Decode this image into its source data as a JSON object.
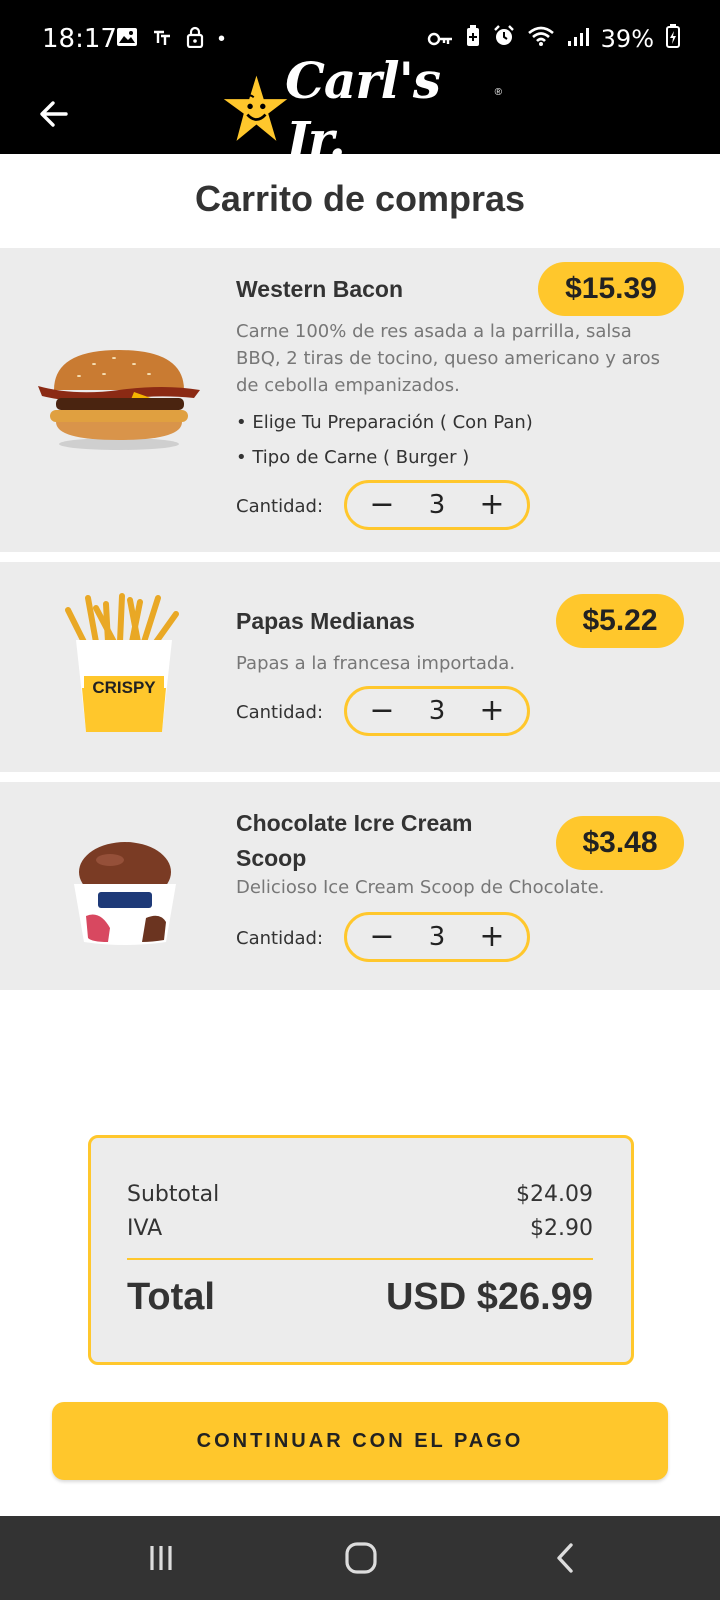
{
  "status_bar": {
    "time": "18:17",
    "dot": "•",
    "battery": "39%"
  },
  "header": {
    "brand": "Carl's Jr.",
    "brand_reg": "®"
  },
  "page": {
    "title": "Carrito de compras"
  },
  "items": [
    {
      "name": "Western Bacon",
      "price": "$15.39",
      "description": "Carne 100% de res asada a la parrilla, salsa BBQ, 2 tiras de tocino, queso americano y aros de cebolla empanizados.",
      "options": [
        "• Elige Tu Preparación ( Con Pan)",
        "• Tipo de Carne ( Burger )"
      ],
      "quantity_label": "Cantidad:",
      "quantity": "3",
      "minus": "−",
      "plus": "+"
    },
    {
      "name": "Papas Medianas",
      "price": "$5.22",
      "description": "Papas a la francesa importada.",
      "quantity_label": "Cantidad:",
      "quantity": "3",
      "minus": "−",
      "plus": "+",
      "image_text": "CRISPY"
    },
    {
      "name": "Chocolate Icre Cream Scoop",
      "price": "$3.48",
      "description": "Delicioso Ice Cream Scoop de Chocolate.",
      "quantity_label": "Cantidad:",
      "quantity": "3",
      "minus": "−",
      "plus": "+"
    }
  ],
  "summary": {
    "subtotal_label": "Subtotal",
    "subtotal_value": "$24.09",
    "iva_label": "IVA",
    "iva_value": "$2.90",
    "total_label": "Total",
    "total_value": "USD $26.99"
  },
  "actions": {
    "continue_label": "CONTINUAR CON EL PAGO"
  },
  "colors": {
    "accent": "#ffc72c",
    "header_bg": "#000000",
    "card_bg": "#ececec",
    "nav_bg": "#333333"
  }
}
